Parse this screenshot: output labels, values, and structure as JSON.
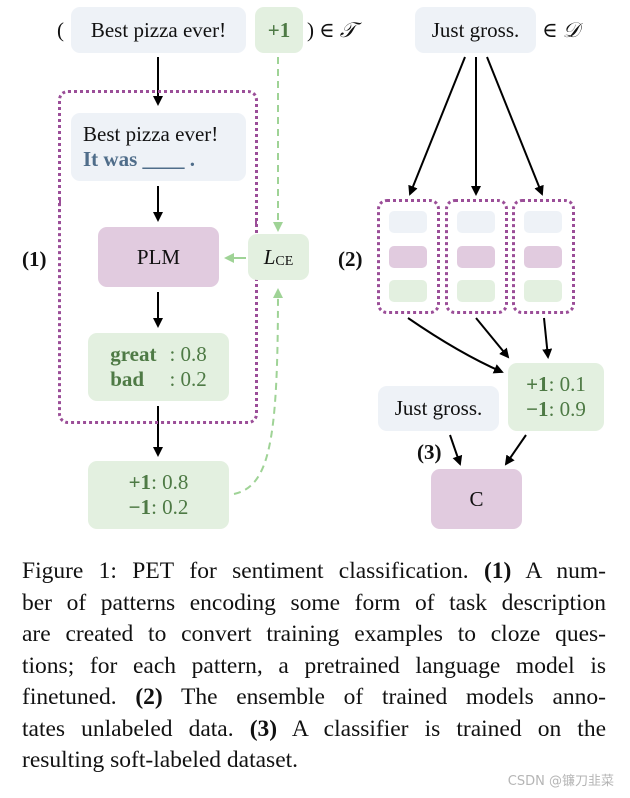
{
  "figure": {
    "training_example": {
      "open_paren": "(",
      "text": "Best pizza ever!",
      "label": "+1",
      "close_paren": ")",
      "set_symbol": "∈ 𝒯"
    },
    "pattern_box": {
      "text_line1": "Best pizza ever!",
      "text_line2": "It was ____ ."
    },
    "plm_label": "PLM",
    "loss": {
      "main": "L",
      "subscript": "CE"
    },
    "verbalizer_output": [
      {
        "token": "great",
        "sep": ":",
        "prob": "0.8"
      },
      {
        "token": "bad",
        "sep": ":",
        "prob": "0.2"
      }
    ],
    "label_output": [
      {
        "label": "+1",
        "sep": ":",
        "prob": "0.8"
      },
      {
        "label": "−1",
        "sep": ":",
        "prob": "0.2"
      }
    ],
    "step_labels": {
      "step1": "(1)",
      "step2": "(2)",
      "step3": "(3)"
    },
    "unlabeled_example": {
      "text": "Just gross.",
      "set_symbol": "∈ 𝒟"
    },
    "ensemble_output": [
      {
        "label": "+1",
        "sep": ":",
        "prob": "0.1"
      },
      {
        "label": "−1",
        "sep": ":",
        "prob": "0.9"
      }
    ],
    "classifier_input": "Just gross.",
    "classifier_label": "C",
    "colors": {
      "text_box": "#eef2f7",
      "model_box": "#e1cbdf",
      "output_box": "#e3f0e0",
      "output_text": "#4e7a45",
      "pattern_text": "#4f6d8a",
      "dotted_border": "#9b4e98",
      "loss_arrow": "#9fd396"
    }
  },
  "caption": {
    "lines": [
      [
        "Figure 1: ",
        "PET",
        " for sentiment classification. ",
        "(1)",
        " A num-"
      ],
      [
        "ber of patterns encoding some form of task description"
      ],
      [
        "are created to convert training examples to cloze ques-"
      ],
      [
        "tions; for each pattern, a pretrained language model is"
      ],
      [
        "finetuned.  ",
        "(2)",
        " The ensemble of trained models anno-"
      ],
      [
        "tates unlabeled data.  ",
        "(3)",
        " A classifier is trained on the"
      ],
      [
        "resulting soft-labeled dataset."
      ]
    ]
  },
  "watermark": "CSDN @镰刀韭菜"
}
